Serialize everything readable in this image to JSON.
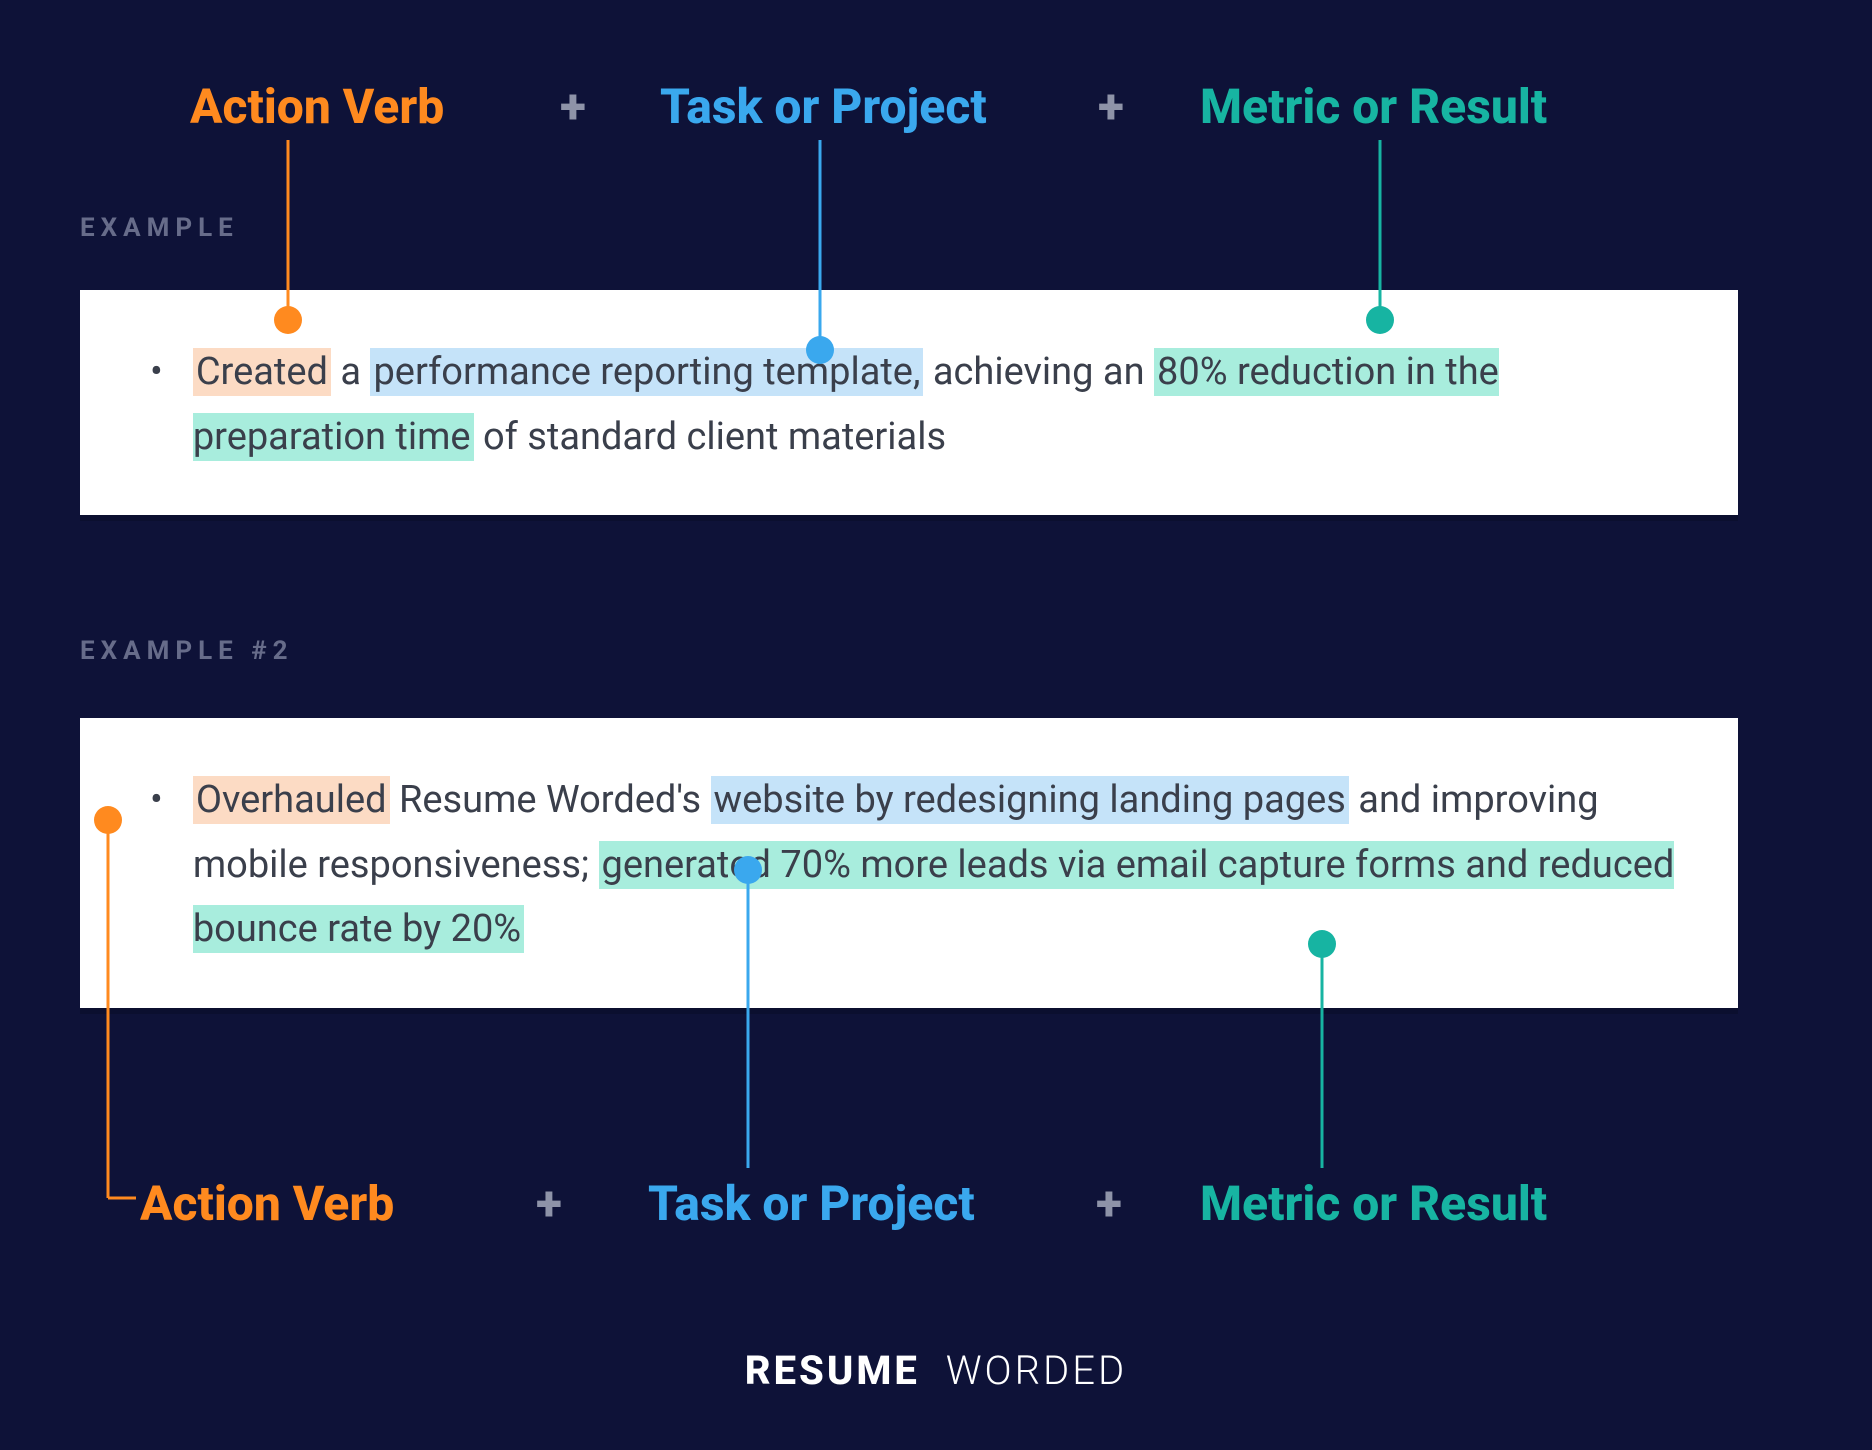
{
  "formula": {
    "verb": "Action Verb",
    "plus": "+",
    "task": "Task or Project",
    "metric": "Metric or Result"
  },
  "sections": {
    "example1_label": "EXAMPLE",
    "example2_label": "EXAMPLE #2"
  },
  "example1": {
    "verb": "Created",
    "plain1": " a ",
    "task": "performance reporting template,",
    "plain2": " achieving an ",
    "metric": "80% reduction in the preparation time",
    "plain3": " of standard client materials"
  },
  "example2": {
    "verb": "Overhauled",
    "plain1": " Resume Worded's ",
    "task": "website by redesigning landing pages",
    "plain2": " and improving mobile responsiveness; ",
    "metric": "generated 70% more leads via email capture forms and reduced bounce rate by 20%"
  },
  "footer": {
    "bold": "RESUME",
    "light": "WORDED"
  },
  "colors": {
    "bg": "#0e1238",
    "verb": "#ff8a1f",
    "task": "#3aa8ee",
    "metric": "#17b4a2"
  }
}
